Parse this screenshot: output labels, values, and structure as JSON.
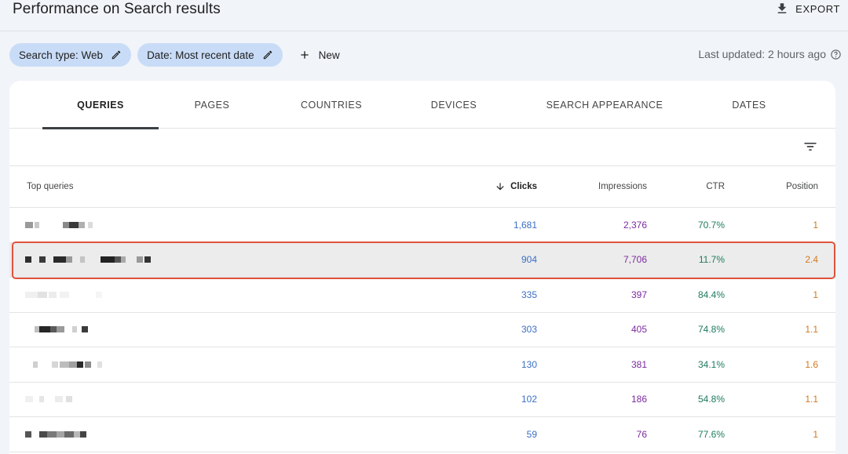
{
  "header": {
    "title": "Performance on Search results",
    "export_label": "EXPORT"
  },
  "filters": {
    "chips": [
      {
        "label": "Search type: Web"
      },
      {
        "label": "Date: Most recent date"
      }
    ],
    "new_label": "New",
    "last_updated": "Last updated: 2 hours ago"
  },
  "tabs": [
    {
      "label": "QUERIES",
      "active": true
    },
    {
      "label": "PAGES"
    },
    {
      "label": "COUNTRIES"
    },
    {
      "label": "DEVICES"
    },
    {
      "label": "SEARCH APPEARANCE"
    },
    {
      "label": "DATES"
    }
  ],
  "table": {
    "columns": {
      "query": "Top queries",
      "clicks": "Clicks",
      "impressions": "Impressions",
      "ctr": "CTR",
      "position": "Position"
    },
    "rows": [
      {
        "clicks": "1,681",
        "impressions": "2,376",
        "ctr": "70.7%",
        "position": "1"
      },
      {
        "clicks": "904",
        "impressions": "7,706",
        "ctr": "11.7%",
        "position": "2.4",
        "selected": true
      },
      {
        "clicks": "335",
        "impressions": "397",
        "ctr": "84.4%",
        "position": "1"
      },
      {
        "clicks": "303",
        "impressions": "405",
        "ctr": "74.8%",
        "position": "1.1"
      },
      {
        "clicks": "130",
        "impressions": "381",
        "ctr": "34.1%",
        "position": "1.6"
      },
      {
        "clicks": "102",
        "impressions": "186",
        "ctr": "54.8%",
        "position": "1.1"
      },
      {
        "clicks": "59",
        "impressions": "76",
        "ctr": "77.6%",
        "position": "1"
      }
    ]
  },
  "colors": {
    "clicks": "#3b6fc4",
    "impressions": "#7b2a9e",
    "ctr": "#1e7b5e",
    "position": "#d27a1e",
    "chip_bg": "#c9dcf7",
    "highlight_outline": "#e0533b"
  },
  "icons": {
    "export": "download-icon",
    "chip_edit": "pencil-icon",
    "new": "plus-icon",
    "help": "help-circle-icon",
    "filter": "filter-lines-icon",
    "sort": "arrow-down-icon"
  }
}
